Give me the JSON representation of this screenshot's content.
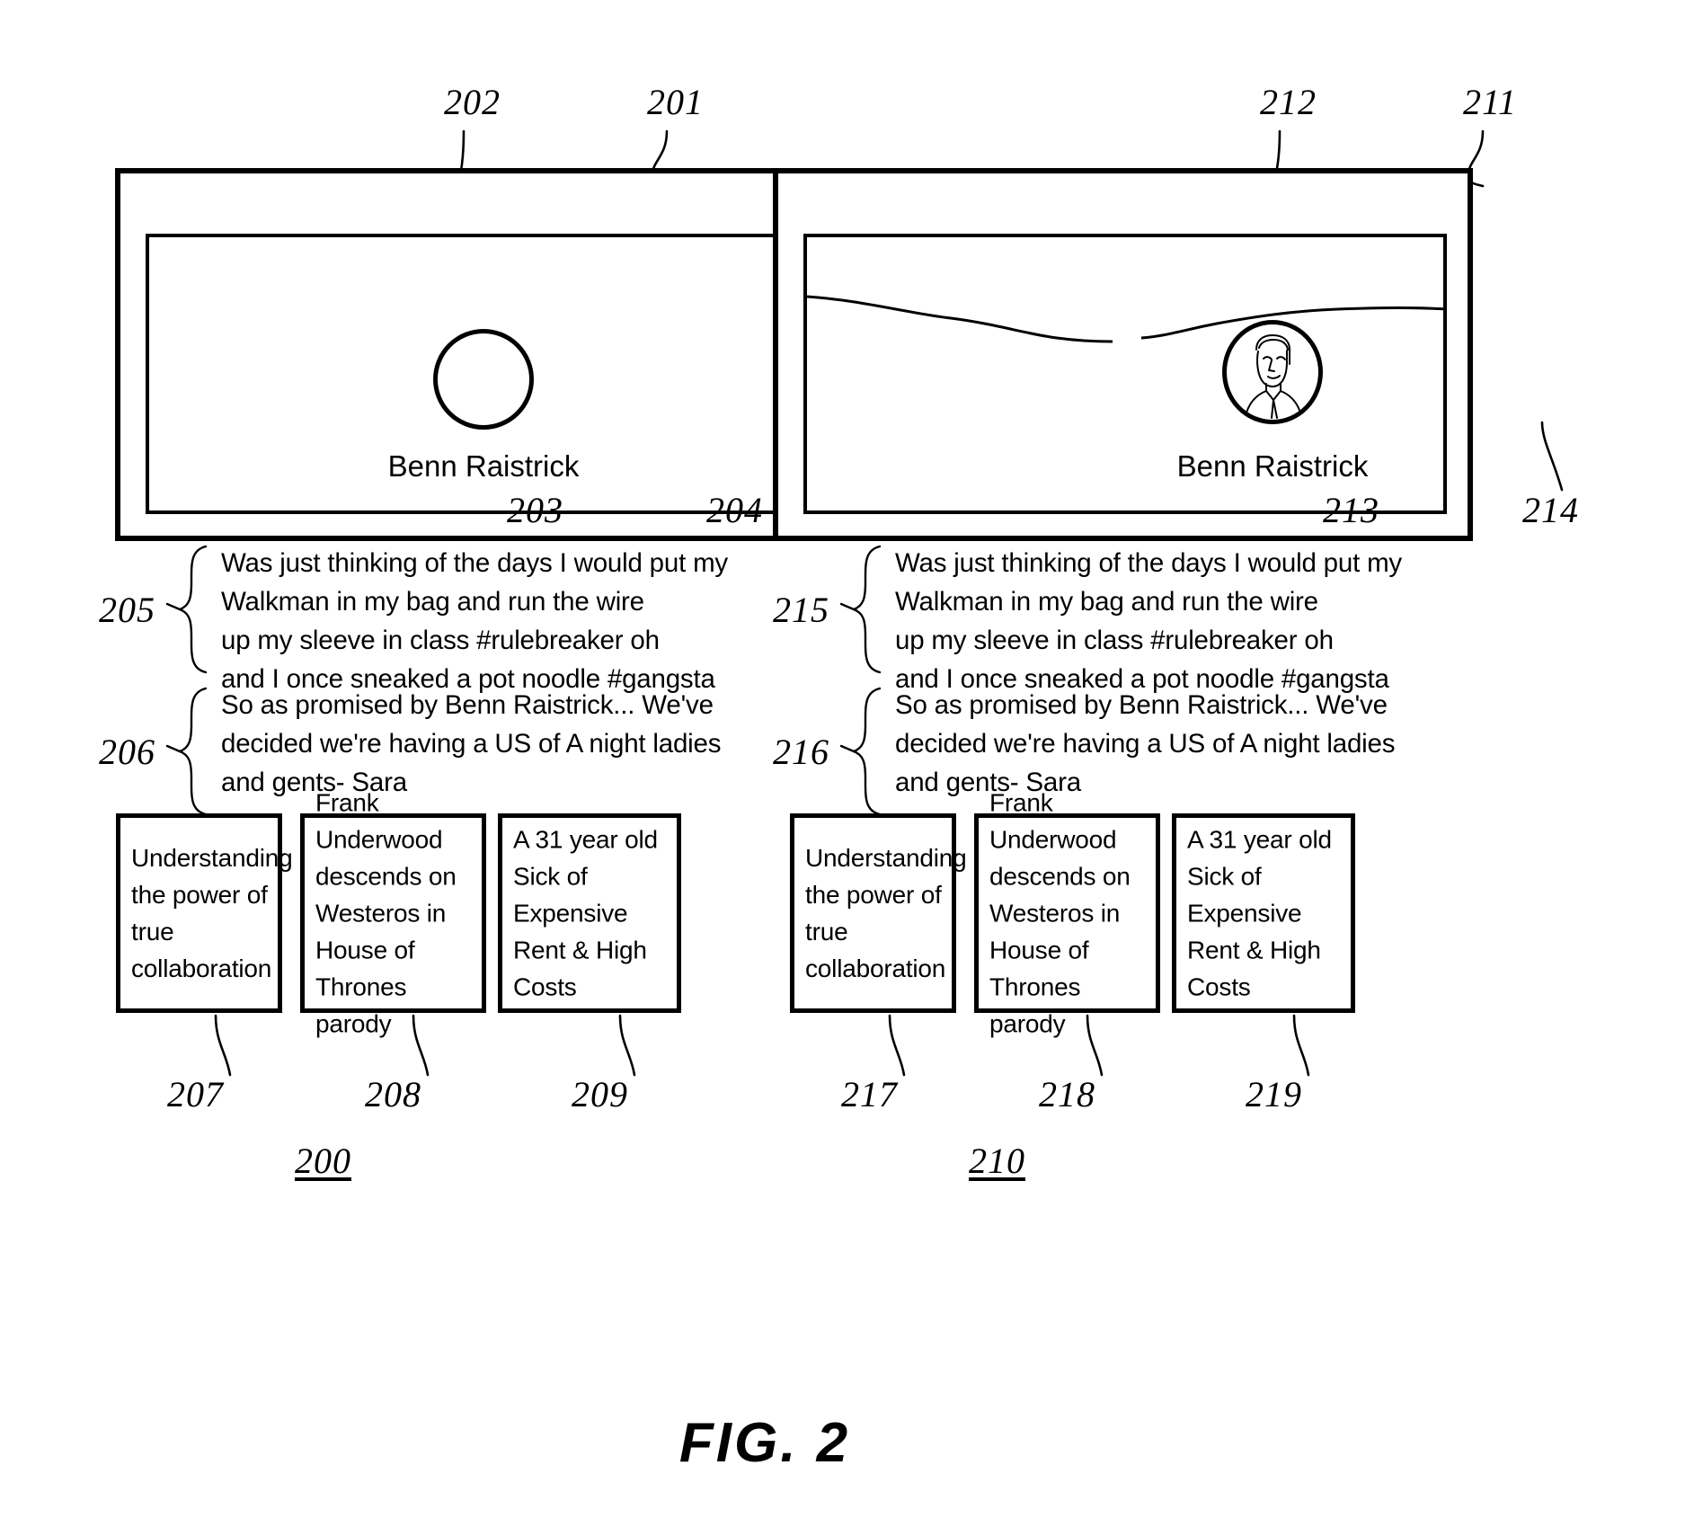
{
  "figure": {
    "caption": "FIG. 2",
    "left_label": "200",
    "right_label": "210"
  },
  "panels": [
    {
      "id": "left",
      "outer_ref": "201",
      "avatar_ref": "202",
      "name_ref": "203",
      "inner_ref": "204",
      "profile_name": "Benn Raistrick",
      "has_avatar_image": false,
      "has_background_image": false,
      "paragraphs": [
        {
          "ref": "205",
          "text": "Was just thinking of the days I would put my\nWalkman in my bag and run the wire\nup my sleeve in class #rulebreaker oh\nand I once sneaked a pot noodle #gangsta"
        },
        {
          "ref": "206",
          "text": "So as promised by Benn Raistrick... We've\ndecided we're having a US of A night ladies\nand gents- Sara"
        }
      ],
      "cards": [
        {
          "ref": "207",
          "text": "Understanding\nthe power of\ntrue collaboration"
        },
        {
          "ref": "208",
          "text": "Frank Underwood\ndescends on\nWesteros in\nHouse of Thrones\nparody"
        },
        {
          "ref": "209",
          "text": "A 31 year old\nSick of Expensive\nRent & High\nCosts"
        }
      ]
    },
    {
      "id": "right",
      "outer_ref": "211",
      "avatar_ref": "212",
      "name_ref": "213",
      "inner_ref": "214",
      "profile_name": "Benn Raistrick",
      "has_avatar_image": true,
      "has_background_image": true,
      "paragraphs": [
        {
          "ref": "215",
          "text": "Was just thinking of the days I would put my\nWalkman in my bag and run the wire\nup my sleeve in class #rulebreaker oh\nand I once sneaked a pot noodle #gangsta"
        },
        {
          "ref": "216",
          "text": "So as promised by Benn Raistrick... We've\ndecided we're having a US of A night ladies\nand gents- Sara"
        }
      ],
      "cards": [
        {
          "ref": "217",
          "text": "Understanding\nthe power of\ntrue collaboration"
        },
        {
          "ref": "218",
          "text": "Frank Underwood\ndescends on\nWesteros in\nHouse of Thrones\nparody"
        },
        {
          "ref": "219",
          "text": "A 31 year old\nSick of Expensive\nRent & High\nCosts"
        }
      ]
    }
  ],
  "colors": {
    "ink": "#000000",
    "paper": "#ffffff"
  }
}
